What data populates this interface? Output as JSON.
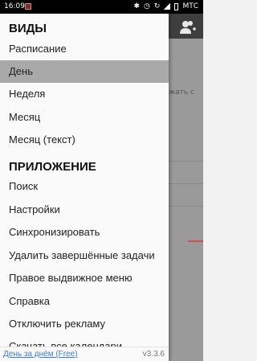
{
  "status_bar": {
    "time": "16:09",
    "carrier": "МТС",
    "icons": [
      "notification-icon",
      "bluetooth-icon",
      "alarm-icon",
      "sync-icon",
      "signal-icon",
      "battery-icon"
    ]
  },
  "drawer": {
    "section_views": "ВИДЫ",
    "views": [
      {
        "label": "Расписание",
        "active": false
      },
      {
        "label": "День",
        "active": true
      },
      {
        "label": "Неделя",
        "active": false
      },
      {
        "label": "Месяц",
        "active": false
      },
      {
        "label": "Месяц (текст)",
        "active": false
      }
    ],
    "section_app": "ПРИЛОЖЕНИЕ",
    "app_items": [
      {
        "label": "Поиск"
      },
      {
        "label": "Настройки"
      },
      {
        "label": "Синхронизировать"
      },
      {
        "label": "Удалить завершённые задачи"
      },
      {
        "label": "Правое выдвижное меню"
      },
      {
        "label": "Справка"
      },
      {
        "label": "Отключить рекламу"
      },
      {
        "label": "Скачать все календари"
      }
    ],
    "footer": {
      "app_name": "День за днём (Free)",
      "version": "v3.3.6"
    }
  },
  "background": {
    "hint": "жать с",
    "accent_color": "#d05050"
  }
}
